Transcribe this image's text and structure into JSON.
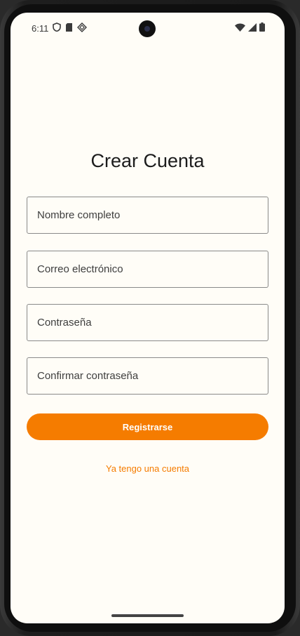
{
  "status_bar": {
    "time": "6:11",
    "left_icons": [
      "shield-icon",
      "sd-card-icon",
      "diamond-icon"
    ],
    "right_icons": [
      "wifi-icon",
      "signal-icon",
      "battery-icon"
    ]
  },
  "page": {
    "title": "Crear Cuenta"
  },
  "form": {
    "fields": [
      {
        "placeholder": "Nombre completo",
        "value": ""
      },
      {
        "placeholder": "Correo electrónico",
        "value": ""
      },
      {
        "placeholder": "Contraseña",
        "value": ""
      },
      {
        "placeholder": "Confirmar contraseña",
        "value": ""
      }
    ],
    "submit_label": "Registrarse",
    "login_link": "Ya tengo una cuenta"
  },
  "colors": {
    "accent": "#f57c00",
    "background": "#fffdf7"
  }
}
